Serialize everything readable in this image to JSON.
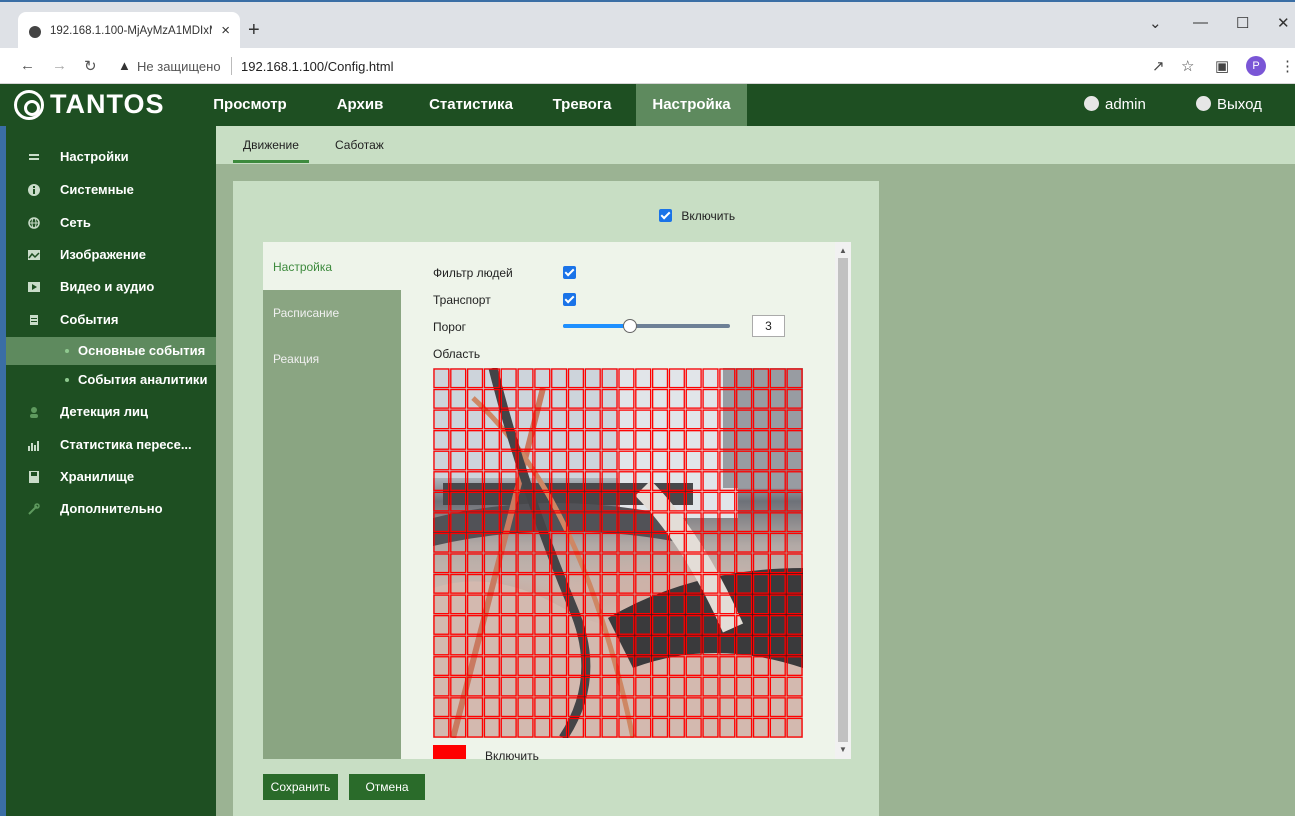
{
  "browser": {
    "tab_title": "192.168.1.100-MjAyMzA1MDIxM",
    "tab_close": "×",
    "new_tab": "+",
    "insecure_label": "Не защищено",
    "url": "192.168.1.100/Config.html",
    "profile_initial": "P"
  },
  "header": {
    "logo": "TANTOS",
    "nav": [
      "Просмотр",
      "Архив",
      "Статистика",
      "Тревога",
      "Настройка"
    ],
    "active_nav": "Настройка",
    "user": "admin",
    "logout": "Выход"
  },
  "sidebar": {
    "items": [
      {
        "label": "Настройки",
        "icon": "menu-icon"
      },
      {
        "label": "Системные",
        "icon": "info-icon"
      },
      {
        "label": "Сеть",
        "icon": "globe-icon"
      },
      {
        "label": "Изображение",
        "icon": "image-icon"
      },
      {
        "label": "Видео и аудио",
        "icon": "video-icon"
      },
      {
        "label": "События",
        "icon": "events-icon"
      }
    ],
    "subitems": [
      {
        "label": "Основные события",
        "active": true
      },
      {
        "label": "События аналитики",
        "active": false
      }
    ],
    "items_after": [
      {
        "label": "Детекция лиц",
        "icon": "face-icon"
      },
      {
        "label": "Статистика пересе...",
        "icon": "bar-chart-icon"
      },
      {
        "label": "Хранилище",
        "icon": "storage-icon"
      },
      {
        "label": "Дополнительно",
        "icon": "tools-icon"
      }
    ]
  },
  "subtabs": [
    "Движение",
    "Саботаж"
  ],
  "active_subtab": "Движение",
  "enable_label": "Включить",
  "enable_checked": true,
  "left_tabs": [
    "Настройка",
    "Расписание",
    "Реакция"
  ],
  "active_left_tab": "Настройка",
  "form": {
    "people_filter_label": "Фильтр людей",
    "people_filter_checked": true,
    "transport_label": "Транспорт",
    "transport_checked": true,
    "threshold_label": "Порог",
    "threshold_value": "3",
    "threshold_fraction": 0.4,
    "area_label": "Область",
    "grid_cols": 22,
    "grid_rows": 18,
    "area_color": "#ff0000",
    "area_enable_label": "Включить"
  },
  "buttons": {
    "save": "Сохранить",
    "cancel": "Отмена"
  },
  "colors": {
    "header_bg": "#1e4f22",
    "active_nav_bg": "#5e8a5e",
    "button_bg": "#2a6b2a",
    "checkbox": "#1a73e8"
  }
}
